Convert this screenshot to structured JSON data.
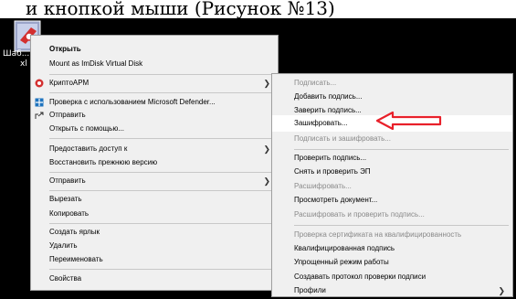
{
  "top_text": "и кнопкой мыши (Рисунок №13)",
  "desktop": {
    "icon_label_line1": "Шаб...",
    "icon_label_line2": "xl"
  },
  "main_menu": {
    "open": "Открыть",
    "mount": "Mount as ImDisk Virtual Disk",
    "cryptoarm": "КриптоАРМ",
    "defender": "Проверка с использованием Microsoft Defender...",
    "share": "Отправить",
    "open_with": "Открыть с помощью...",
    "grant_access": "Предоставить доступ к",
    "restore": "Восстановить прежнюю версию",
    "send_to": "Отправить",
    "cut": "Вырезать",
    "copy": "Копировать",
    "create_shortcut": "Создать ярлык",
    "delete": "Удалить",
    "rename": "Переименовать",
    "properties": "Свойства"
  },
  "sub_menu": {
    "sign_dis": "Подписать...",
    "add_sig": "Добавить подпись...",
    "cosign": "Заверить подпись...",
    "encrypt": "Зашифровать...",
    "sign_encrypt": "Подписать и зашифровать...",
    "verify": "Проверить подпись...",
    "remove_verify": "Снять и проверить ЭП",
    "decrypt": "Расшифровать...",
    "view": "Просмотреть документ...",
    "decrypt_verify": "Расшифровать и проверить подпись...",
    "cert_check": "Проверка сертификата на квалифицированность",
    "qualified": "Квалифицированная подпись",
    "simplified": "Упрощенный режим работы",
    "protocol": "Создавать протокол проверки подписи",
    "profiles": "Профили"
  },
  "colors": {
    "pointer": "#e8202a",
    "menu_bg": "#f0f0f0",
    "disabled_text": "#8a8a8a"
  },
  "icons": [
    "file-icon",
    "cryptoarm-icon",
    "defender-shield-icon",
    "share-icon",
    "submenu-arrow-icon",
    "red-pointer-arrow-icon"
  ]
}
